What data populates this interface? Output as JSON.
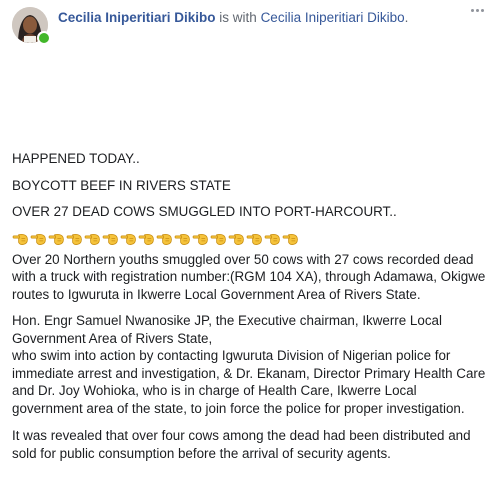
{
  "post": {
    "author": "Cecilia Iniperitiari Dikibo",
    "with_text": " is with ",
    "tagged": "Cecilia Iniperitiari Dikibo",
    "tagged_suffix": ".",
    "more_icon": "more-options-icon",
    "colors": {
      "link": "#365899",
      "online": "#42b72a",
      "text": "#1c1e21",
      "secondary": "#616770"
    }
  },
  "body": {
    "line1": "HAPPENED TODAY..",
    "line2": "BOYCOTT BEEF IN RIVERS STATE",
    "line3": "OVER 27 DEAD COWS SMUGGLED INTO PORT-HARCOURT..",
    "emoji": {
      "name": "backhand-index-pointing-left-emoji",
      "count": 16
    },
    "para1": "Over 20 Northern youths smuggled over 50 cows with 27 cows recorded dead with a truck with registration number:(RGM 104 XA), through Adamawa, Okigwe routes to Igwuruta in Ikwerre Local Government Area of Rivers State.",
    "para2a": "Hon. Engr Samuel Nwanosike JP, the Executive chairman, Ikwerre Local Government Area of Rivers State,",
    "para2b": "who swim into action by contacting Igwuruta Division of Nigerian police for immediate arrest and investigation, & Dr. Ekanam, Director Primary Health Care and Dr. Joy Wohioka, who is in charge of Health Care, Ikwerre Local government area of the state, to join force the police for proper investigation.",
    "para3": "It was revealed that over four cows among the dead had been distributed and sold for public consumption before the arrival of security agents."
  }
}
